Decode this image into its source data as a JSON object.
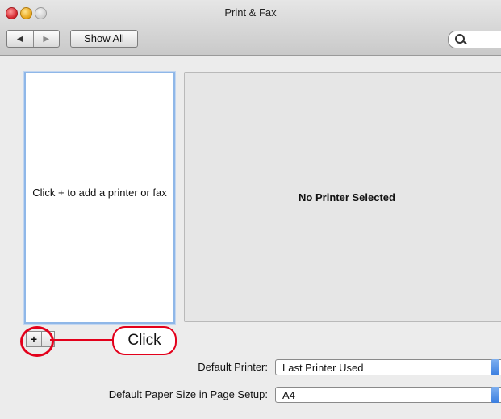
{
  "window": {
    "title": "Print & Fax"
  },
  "toolbar": {
    "back_glyph": "◀",
    "forward_glyph": "▶",
    "show_all_label": "Show All"
  },
  "printer_list": {
    "empty_message": "Click + to add a printer or fax"
  },
  "details_pane": {
    "message": "No Printer Selected"
  },
  "list_controls": {
    "add_label": "+"
  },
  "annotation": {
    "callout_text": "Click",
    "color": "#e3001b"
  },
  "settings": {
    "default_printer_label": "Default Printer:",
    "default_printer_value": "Last Printer Used",
    "paper_size_label": "Default Paper Size in Page Setup:",
    "paper_size_value": "A4"
  },
  "icons": [
    "close-icon",
    "minimize-icon",
    "zoom-icon",
    "back-arrow-icon",
    "forward-arrow-icon",
    "search-icon",
    "popup-arrow-icon"
  ]
}
